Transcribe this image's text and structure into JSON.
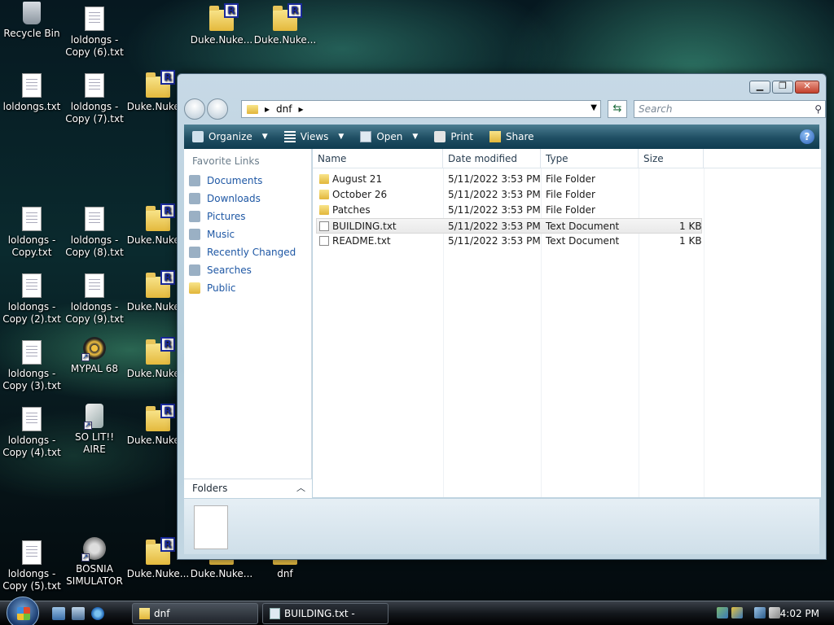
{
  "desktop": {
    "icons": [
      {
        "label": "Recycle Bin"
      },
      {
        "label": "loldongs - Copy (6).txt"
      },
      {
        "label": "Duke.Nuke..."
      },
      {
        "label": "Duke.Nuke..."
      },
      {
        "label": "loldongs.txt"
      },
      {
        "label": "loldongs - Copy (7).txt"
      },
      {
        "label": "Duke.Nuke..."
      },
      {
        "label": "loldongs - Copy.txt"
      },
      {
        "label": "loldongs - Copy (8).txt"
      },
      {
        "label": "Duke.Nuke..."
      },
      {
        "label": "loldongs - Copy (2).txt"
      },
      {
        "label": "loldongs - Copy (9).txt"
      },
      {
        "label": "Duke.Nuke..."
      },
      {
        "label": "loldongs - Copy (3).txt"
      },
      {
        "label": "MYPAL 68"
      },
      {
        "label": "Duke.Nuke..."
      },
      {
        "label": "loldongs - Copy (4).txt"
      },
      {
        "label": "SO LIT!! AIRE"
      },
      {
        "label": "Duke.Nuke..."
      },
      {
        "label": "loldongs - Copy (5).txt"
      },
      {
        "label": "BOSNIA SIMULATOR"
      },
      {
        "label": "Duke.Nuke..."
      },
      {
        "label": "Duke.Nuke..."
      },
      {
        "label": "dnf"
      }
    ]
  },
  "window": {
    "buttons": {
      "minimize": "▁",
      "maximize": "❐",
      "close": "✕"
    },
    "address": {
      "crumb": "dnf",
      "sep": "▸"
    },
    "search": {
      "placeholder": "Search",
      "icon": "search-icon"
    },
    "toolbar": {
      "organize": "Organize",
      "views": "Views",
      "open": "Open",
      "print": "Print",
      "share": "Share",
      "help": "?"
    },
    "nav": {
      "header": "Favorite Links",
      "items": [
        {
          "label": "Documents",
          "icon": "documents-icon"
        },
        {
          "label": "Downloads",
          "icon": "downloads-icon"
        },
        {
          "label": "Pictures",
          "icon": "pictures-icon"
        },
        {
          "label": "Music",
          "icon": "music-icon"
        },
        {
          "label": "Recently Changed",
          "icon": "recently-changed-icon"
        },
        {
          "label": "Searches",
          "icon": "searches-icon"
        },
        {
          "label": "Public",
          "icon": "folder-icon"
        }
      ],
      "folders_label": "Folders"
    },
    "columns": [
      "Name",
      "Date modified",
      "Type",
      "Size"
    ],
    "files": [
      {
        "name": "August 21",
        "date": "5/11/2022 3:53 PM",
        "type": "File Folder",
        "size": "",
        "kind": "folder"
      },
      {
        "name": "October 26",
        "date": "5/11/2022 3:53 PM",
        "type": "File Folder",
        "size": "",
        "kind": "folder"
      },
      {
        "name": "Patches",
        "date": "5/11/2022 3:53 PM",
        "type": "File Folder",
        "size": "",
        "kind": "folder"
      },
      {
        "name": "BUILDING.txt",
        "date": "5/11/2022 3:53 PM",
        "type": "Text Document",
        "size": "1 KB",
        "kind": "txt",
        "selected": true
      },
      {
        "name": "README.txt",
        "date": "5/11/2022 3:53 PM",
        "type": "Text Document",
        "size": "1 KB",
        "kind": "txt"
      }
    ]
  },
  "taskbar": {
    "tasks": [
      {
        "label": "dnf",
        "active": false
      },
      {
        "label": "BUILDING.txt - Note...",
        "active": true
      }
    ],
    "clock": "4:02 PM"
  },
  "colors": {
    "link": "#1e57a4",
    "toolbar": "#1f4e63",
    "taskbar": "#14181d"
  }
}
